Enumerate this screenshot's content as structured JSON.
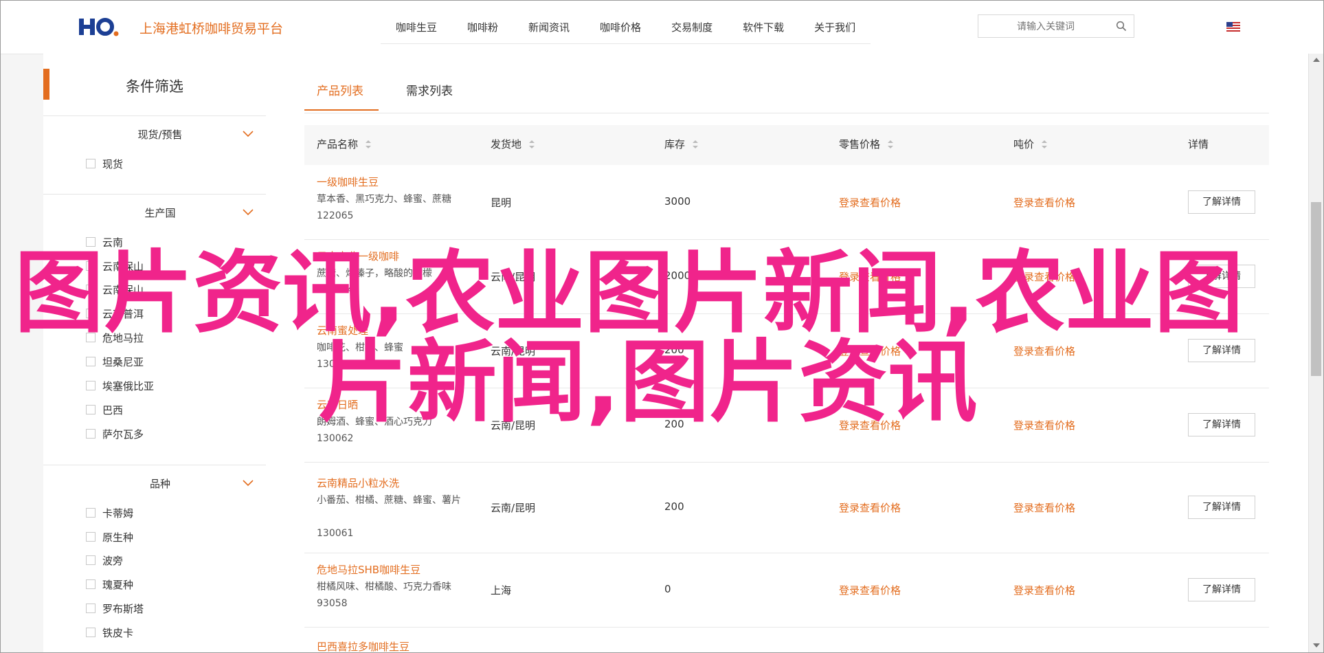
{
  "header": {
    "logo_text": "HO.",
    "site_name": "上海港虹桥咖啡贸易平台",
    "nav": [
      "咖啡生豆",
      "咖啡粉",
      "新闻资讯",
      "咖啡价格",
      "交易制度",
      "软件下载",
      "关于我们"
    ],
    "search_placeholder": "请输入关键词",
    "language_flag": "us-flag-icon"
  },
  "sidebar": {
    "title": "条件筛选",
    "groups": [
      {
        "title": "现货/预售",
        "options": [
          "现货"
        ]
      },
      {
        "title": "生产国",
        "options": [
          "云南",
          "云南保山",
          "云南保山",
          "云南普洱",
          "危地马拉",
          "坦桑尼亚",
          "埃塞俄比亚",
          "巴西",
          "萨尔瓦多"
        ]
      },
      {
        "title": "品种",
        "options": [
          "卡蒂姆",
          "原生种",
          "波旁",
          "瑰夏种",
          "罗布斯塔",
          "铁皮卡"
        ]
      }
    ]
  },
  "tabs": [
    "产品列表",
    "需求列表"
  ],
  "table": {
    "columns": [
      "产品名称",
      "发货地",
      "库存",
      "零售价格",
      "吨价",
      "详情"
    ],
    "rows": [
      {
        "name": "一级咖啡生豆",
        "desc": "草本香、黑巧克力、蜂蜜、蔗糖",
        "code": "122065",
        "origin": "昆明",
        "stock": "3000",
        "retail": "登录查看价格",
        "ton": "登录查看价格",
        "detail": "了解详情"
      },
      {
        "name": "云南商业一级咖啡",
        "desc": "蔗糖、烤榛子，略酸的柠檬",
        "code": "130064",
        "origin": "云南/昆明",
        "stock": "2000",
        "retail": "登录查看价格",
        "ton": "登录查看价格",
        "detail": "了解详情"
      },
      {
        "name": "云南蜜处理",
        "desc": "咖啡花、柑橘、蜂蜜",
        "code": "130063",
        "origin": "云南/昆明",
        "stock": "200",
        "retail": "登录查看价格",
        "ton": "登录查看价格",
        "detail": "了解详情"
      },
      {
        "name": "云南日晒",
        "desc": "朗姆酒、蜂蜜、酒心巧克力",
        "code": "130062",
        "origin": "云南/昆明",
        "stock": "200",
        "retail": "登录查看价格",
        "ton": "登录查看价格",
        "detail": "了解详情"
      },
      {
        "name": "云南精品小粒水洗",
        "desc": "小番茄、柑橘、蔗糖、蜂蜜、薯片",
        "code": "130061",
        "origin": "云南/昆明",
        "stock": "200",
        "retail": "登录查看价格",
        "ton": "登录查看价格",
        "detail": "了解详情"
      },
      {
        "name": "危地马拉SHB咖啡生豆",
        "desc": "柑橘风味、柑橘酸、巧克力香味",
        "code": "93058",
        "origin": "上海",
        "stock": "0",
        "retail": "登录查看价格",
        "ton": "登录查看价格",
        "detail": "了解详情"
      },
      {
        "name": "巴西喜拉多咖啡生豆",
        "desc": "",
        "code": "",
        "origin": "",
        "stock": "",
        "retail": "",
        "ton": "",
        "detail": ""
      }
    ]
  },
  "watermark": {
    "line1": "图片资讯,农业图片新闻,农业图",
    "line2": "片新闻,图片资讯"
  },
  "colors": {
    "accent": "#e36d1f",
    "watermark": "#f0248b"
  }
}
